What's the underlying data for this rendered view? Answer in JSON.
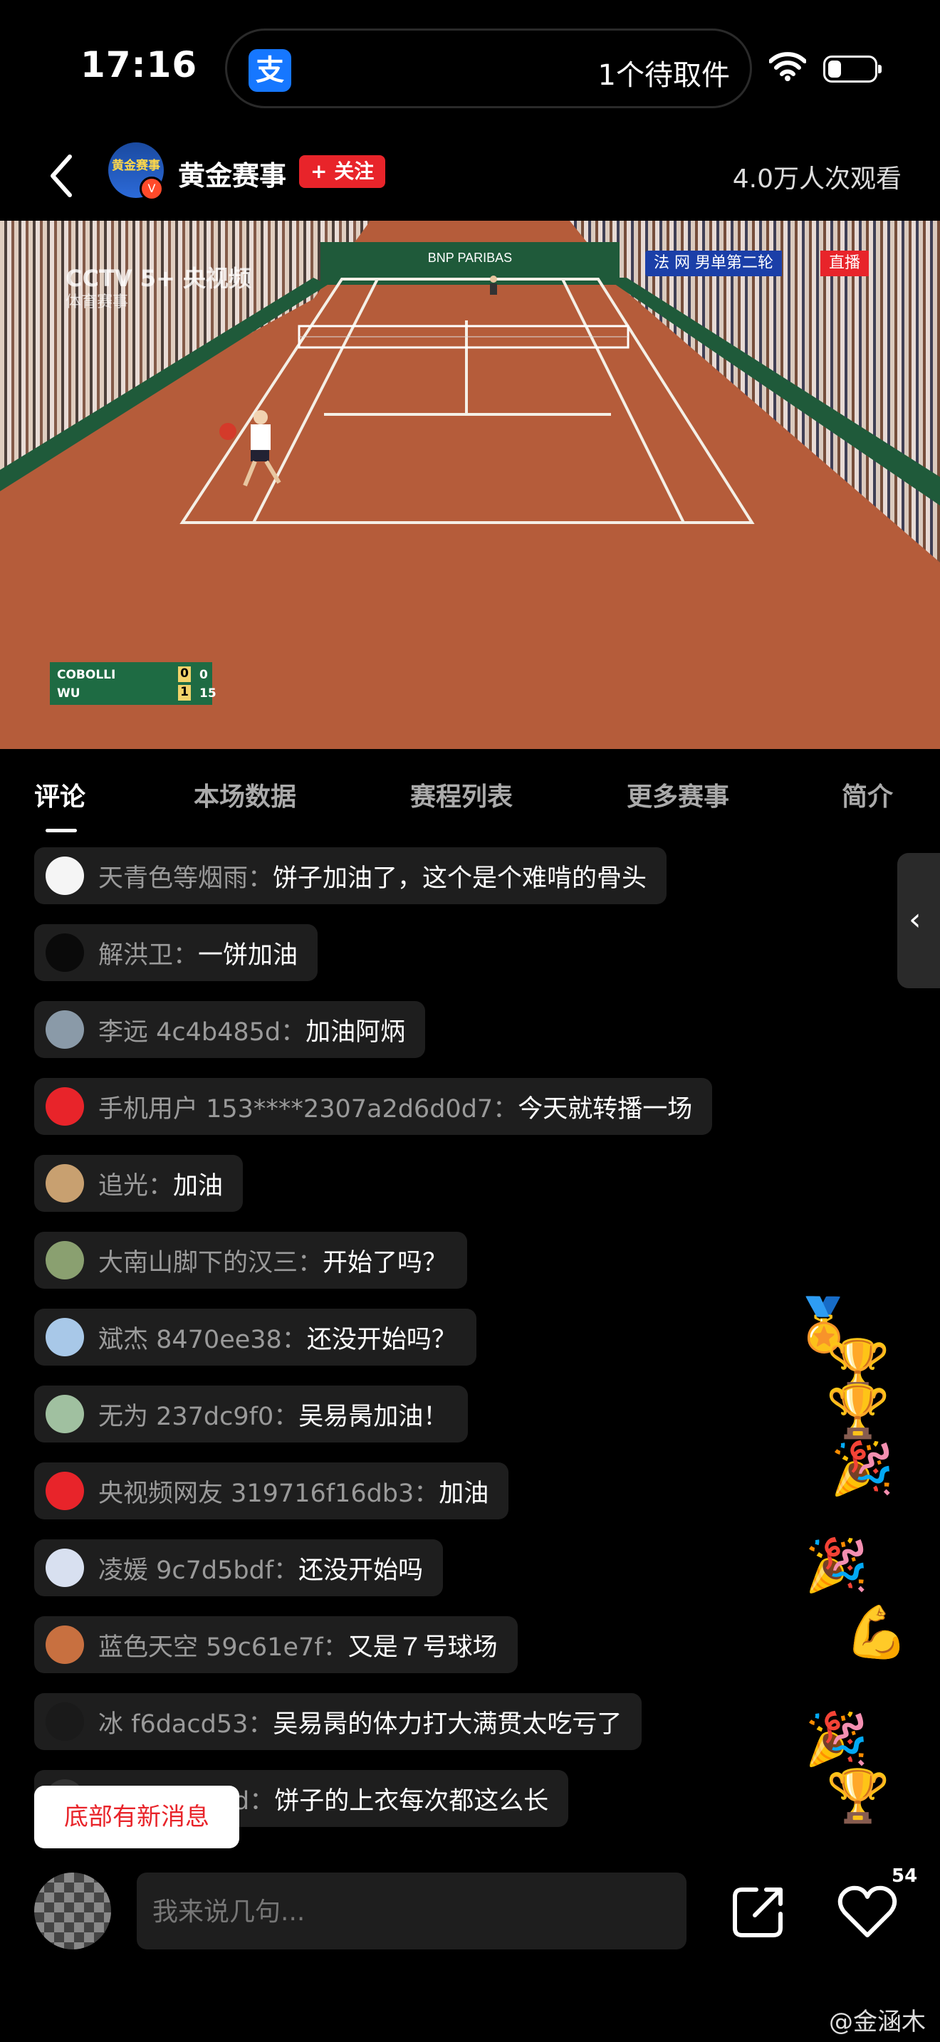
{
  "status_bar": {
    "time": "17:16",
    "app_icon_glyph": "支",
    "pending_text": "1个待取件"
  },
  "header": {
    "channel": "黄金赛事",
    "logo_text": "黄金赛事",
    "follow_label": "+ 关注",
    "viewers": "4.0万人次观看"
  },
  "video": {
    "channel_bug": "CCTV 5+ 央视频",
    "channel_bug_sub": "体育赛事",
    "event_tag": "法 网   男单第二轮",
    "live_tag": "直播",
    "banner": "BNP PARIBAS",
    "scoreboard": [
      {
        "player": "COBOLLI",
        "sets": "0",
        "points": "0"
      },
      {
        "player": "WU",
        "sets": "1",
        "points": "15"
      }
    ]
  },
  "tabs": [
    "评论",
    "本场数据",
    "赛程列表",
    "更多赛事",
    "简介"
  ],
  "comments": [
    {
      "name": "天青色等烟雨：",
      "text": "饼子加油了，这个是个难啃的骨头",
      "avatar_color": "#f5f5f5"
    },
    {
      "name": "解洪卫：",
      "text": "一饼加油",
      "avatar_color": "#0a0a0a"
    },
    {
      "name": "李远 4c4b485d：",
      "text": "加油阿炳",
      "avatar_color": "#8a9aa8"
    },
    {
      "name": "手机用户 153****2307a2d6d0d7：",
      "text": "今天就转播一场",
      "avatar_color": "#e8242a"
    },
    {
      "name": "追光：",
      "text": "加油",
      "avatar_color": "#c8a070"
    },
    {
      "name": "大南山脚下的汉三：",
      "text": "开始了吗？",
      "avatar_color": "#8aa070"
    },
    {
      "name": "斌杰 8470ee38：",
      "text": "还没开始吗？",
      "avatar_color": "#a8c8e8"
    },
    {
      "name": "无为 237dc9f0：",
      "text": "吴易昺加油！",
      "avatar_color": "#a0c0a0"
    },
    {
      "name": "央视频网友 319716f16db3：",
      "text": "加油",
      "avatar_color": "#e8242a"
    },
    {
      "name": "凌媛 9c7d5bdf：",
      "text": "还没开始吗",
      "avatar_color": "#d8e0f0"
    },
    {
      "name": "蓝色天空 59c61e7f：",
      "text": "又是７号球场",
      "avatar_color": "#c87040"
    },
    {
      "name": "冰 f6dacd53：",
      "text": "吴易昺的体力打大满贯太吃亏了",
      "avatar_color": "#1a1a1a"
    },
    {
      "name": "ゞ8a24782d：",
      "text": "饼子的上衣每次都这么长",
      "avatar_color": "#333"
    }
  ],
  "new_message_label": "底部有新消息",
  "input": {
    "placeholder": "我来说几句..."
  },
  "like_count": "54",
  "watermark": "@金涵木",
  "colors": {
    "accent_red": "#e8242a",
    "clay": "#b55c3a",
    "comment_bg": "#1e1e1e"
  }
}
